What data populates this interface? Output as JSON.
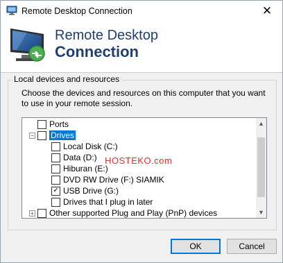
{
  "window": {
    "title": "Remote Desktop Connection",
    "close_glyph": "✕"
  },
  "banner": {
    "line1": "Remote Desktop",
    "line2": "Connection"
  },
  "group": {
    "label": "Local devices and resources",
    "description": "Choose the devices and resources on this computer that you want to use in your remote session."
  },
  "tree": {
    "items": [
      {
        "label": "Ports",
        "checked": false
      },
      {
        "label": "Drives",
        "checked": false,
        "expanded": true,
        "selected": true,
        "expander": "−"
      },
      {
        "label": "Local Disk (C:)",
        "checked": false
      },
      {
        "label": "Data (D:)",
        "checked": false
      },
      {
        "label": "Hiburan (E:)",
        "checked": false
      },
      {
        "label": "DVD RW Drive (F:) SIAMIK",
        "checked": false
      },
      {
        "label": "USB Drive (G:)",
        "checked": true,
        "check_glyph": "✓"
      },
      {
        "label": "Drives that I plug in later",
        "checked": false
      },
      {
        "label": "Other supported Plug and Play (PnP) devices",
        "checked": false,
        "expander": "+"
      }
    ],
    "scroll_up_glyph": "▲",
    "scroll_down_glyph": "▼"
  },
  "watermark": "HOSTEKO.com",
  "buttons": {
    "ok": "OK",
    "cancel": "Cancel"
  },
  "colors": {
    "title_blue": "#1f3f72",
    "selection": "#0078d7",
    "watermark": "#e03030"
  }
}
